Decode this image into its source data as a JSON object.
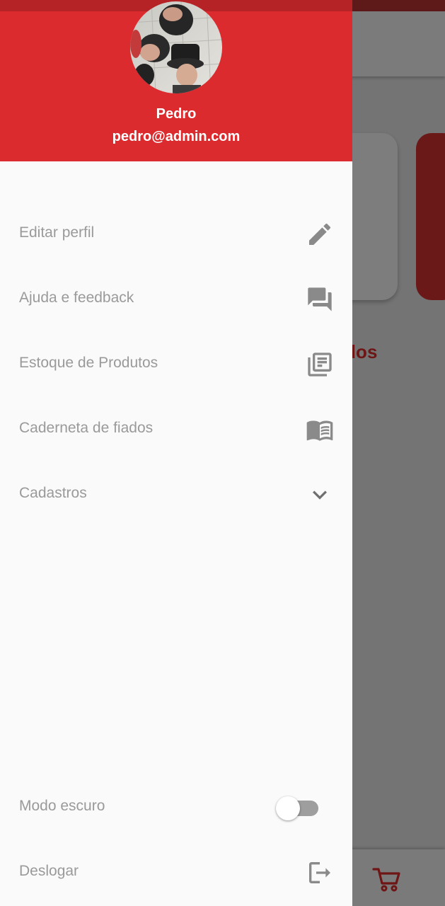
{
  "background": {
    "see_all_text": "r Todos",
    "cart_icon": "shopping-cart-icon",
    "accent": "#6e1515"
  },
  "drawer": {
    "header": {
      "name": "Pedro",
      "email": "pedro@admin.com",
      "color": "#dc2b2f"
    },
    "items": [
      {
        "label": "Editar perfil",
        "icon": "edit-pencil-icon"
      },
      {
        "label": "Ajuda e feedback",
        "icon": "chat-bubbles-icon"
      },
      {
        "label": "Estoque de Produtos",
        "icon": "library-books-icon"
      },
      {
        "label": "Caderneta de fiados",
        "icon": "open-book-icon"
      },
      {
        "label": "Cadastros",
        "icon": "chevron-down-icon"
      }
    ],
    "dark_mode": {
      "label": "Modo escuro",
      "enabled": false
    },
    "logout": {
      "label": "Deslogar",
      "icon": "logout-icon"
    }
  }
}
